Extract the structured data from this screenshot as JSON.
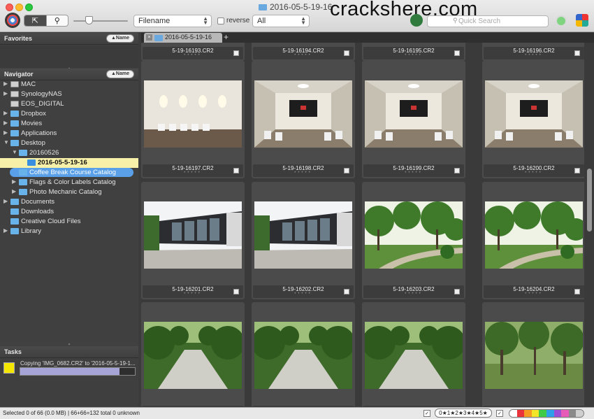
{
  "window": {
    "title": "2016-05-5-19-16"
  },
  "watermark": "crackshere.com",
  "toolbar": {
    "sort_field": "Filename",
    "reverse_label": "reverse",
    "filter_value": "All",
    "search_placeholder": "Quick Search",
    "pointer_glyph": "⇱",
    "magnifier_glyph": "⚲"
  },
  "favorites": {
    "title": "Favorites",
    "sort_label": "▲Name"
  },
  "navigator": {
    "title": "Navigator",
    "sort_label": "▲Name",
    "items": [
      {
        "label": "MAC",
        "indent": 0,
        "twisty": "▶",
        "icon": "drive"
      },
      {
        "label": "SynologyNAS",
        "indent": 0,
        "twisty": "▶",
        "icon": "drive"
      },
      {
        "label": "EOS_DIGITAL",
        "indent": 0,
        "twisty": "",
        "icon": "drive"
      },
      {
        "label": "Dropbox",
        "indent": 0,
        "twisty": "▶",
        "icon": "folder"
      },
      {
        "label": "Movies",
        "indent": 0,
        "twisty": "▶",
        "icon": "folder"
      },
      {
        "label": "Applications",
        "indent": 0,
        "twisty": "▶",
        "icon": "folder"
      },
      {
        "label": "Desktop",
        "indent": 0,
        "twisty": "▼",
        "icon": "folder"
      },
      {
        "label": "20160526",
        "indent": 1,
        "twisty": "▼",
        "icon": "folder"
      },
      {
        "label": "2016-05-5-19-16",
        "indent": 2,
        "twisty": "",
        "icon": "folder",
        "state": "selected"
      },
      {
        "label": "Coffee Break Course Catalog",
        "indent": 1,
        "twisty": "",
        "icon": "folder",
        "state": "highlighted"
      },
      {
        "label": "Flags & Color Labels Catalog",
        "indent": 1,
        "twisty": "▶",
        "icon": "folder"
      },
      {
        "label": "Photo Mechanic Catalog",
        "indent": 1,
        "twisty": "▶",
        "icon": "folder"
      },
      {
        "label": "Documents",
        "indent": 0,
        "twisty": "▶",
        "icon": "folder"
      },
      {
        "label": "Downloads",
        "indent": 0,
        "twisty": "",
        "icon": "folder"
      },
      {
        "label": "Creative Cloud Files",
        "indent": 0,
        "twisty": "",
        "icon": "folder"
      },
      {
        "label": "Library",
        "indent": 0,
        "twisty": "▶",
        "icon": "folder"
      }
    ]
  },
  "tasks": {
    "title": "Tasks",
    "text": "Copying 'IMG_0682.CR2' to '2016-05-5-19-1...",
    "progress": 0.87
  },
  "tab": {
    "label": "2016-05-5-19-16",
    "close_glyph": "×",
    "add_glyph": "+"
  },
  "contact_sheet": {
    "thumbnails": [
      {
        "filename": "5-19-16193.CR2",
        "scene": "none"
      },
      {
        "filename": "5-19-16194.CR2",
        "scene": "none"
      },
      {
        "filename": "5-19-16195.CR2",
        "scene": "none"
      },
      {
        "filename": "5-19-16196.CR2",
        "scene": "none"
      },
      {
        "filename": "5-19-16197.CR2",
        "scene": "room-wall"
      },
      {
        "filename": "5-19-16198.CR2",
        "scene": "room-screen"
      },
      {
        "filename": "5-19-16199.CR2",
        "scene": "room-screen"
      },
      {
        "filename": "5-19-16200.CR2",
        "scene": "room-screen"
      },
      {
        "filename": "5-19-16201.CR2",
        "scene": "building"
      },
      {
        "filename": "5-19-16202.CR2",
        "scene": "building"
      },
      {
        "filename": "5-19-16203.CR2",
        "scene": "park"
      },
      {
        "filename": "5-19-16204.CR2",
        "scene": "park"
      },
      {
        "filename": "",
        "scene": "path"
      },
      {
        "filename": "",
        "scene": "path"
      },
      {
        "filename": "",
        "scene": "path"
      },
      {
        "filename": "",
        "scene": "woods"
      }
    ]
  },
  "status_bar": {
    "text": "Selected 0 of 66 (0.0 MB) | 66+66=132 total  0 unknown",
    "star_filter": "0★1★2★3★4★5★",
    "check_glyph": "✓",
    "color_labels": [
      "#ffffff",
      "#e8343a",
      "#f59a23",
      "#f2e52a",
      "#3fcb47",
      "#2e9fe8",
      "#9a4fd6",
      "#e85ab8",
      "#8a8a8a",
      "#cfcfcf"
    ]
  }
}
